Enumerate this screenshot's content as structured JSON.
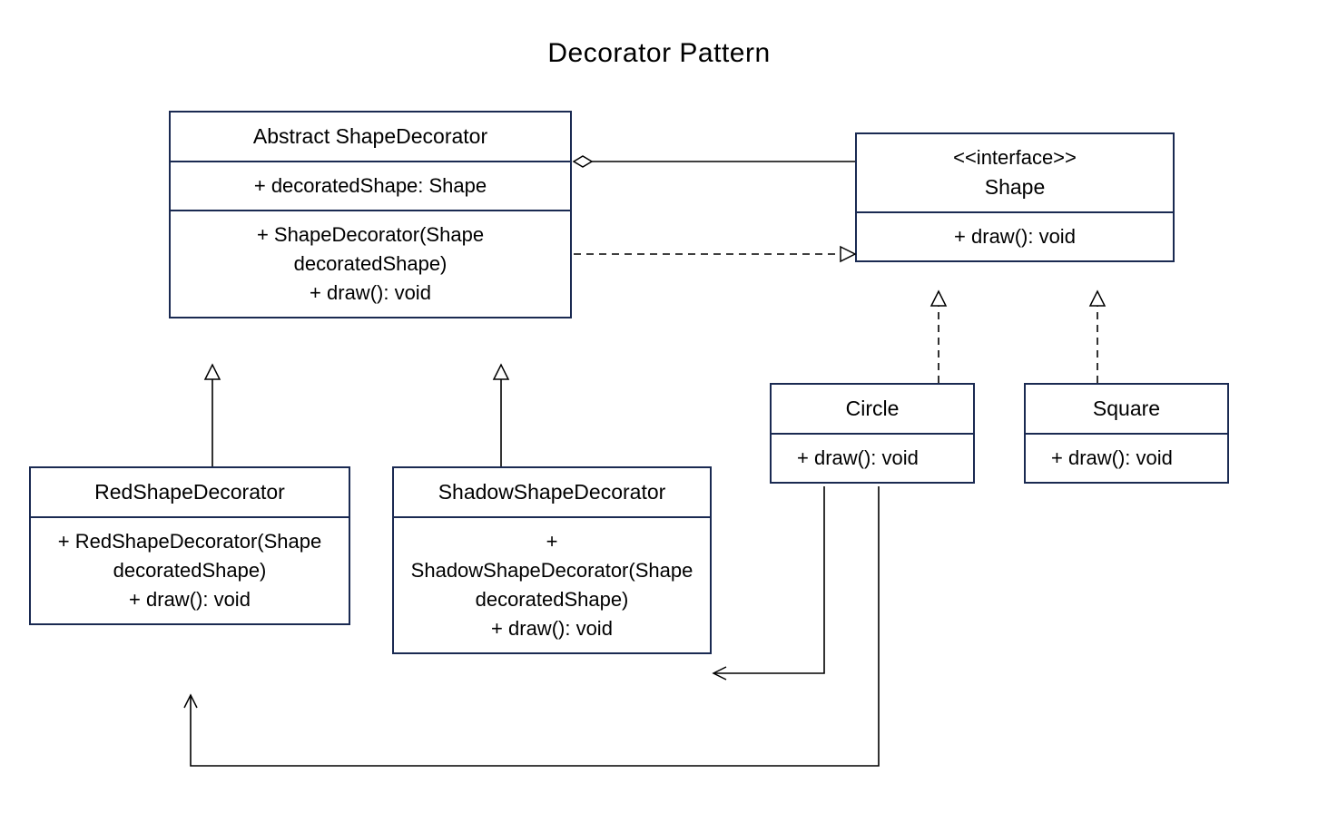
{
  "title": "Decorator Pattern",
  "classes": {
    "shapeDecorator": {
      "name": "Abstract ShapeDecorator",
      "attr1": "+  decoratedShape: Shape",
      "op1": "+  ShapeDecorator(Shape decoratedShape)",
      "op2": "+   draw(): void"
    },
    "shapeIface": {
      "stereo": "<<interface>>",
      "name": "Shape",
      "op1": "+   draw(): void"
    },
    "circle": {
      "name": "Circle",
      "op1": "+   draw(): void"
    },
    "square": {
      "name": "Square",
      "op1": "+   draw(): void"
    },
    "red": {
      "name": "RedShapeDecorator",
      "op1": "+ RedShapeDecorator(Shape decoratedShape)",
      "op2": "+   draw(): void"
    },
    "shadow": {
      "name": "ShadowShapeDecorator",
      "op1": "+ ShadowShapeDecorator(Shape decoratedShape)",
      "op2": "+   draw(): void"
    }
  },
  "relations": [
    {
      "type": "aggregation",
      "from": "shapeDecorator",
      "to": "shapeIface"
    },
    {
      "type": "realization-dashed",
      "from": "shapeDecorator",
      "to": "shapeIface"
    },
    {
      "type": "realization-dashed",
      "from": "circle",
      "to": "shapeIface"
    },
    {
      "type": "realization-dashed",
      "from": "square",
      "to": "shapeIface"
    },
    {
      "type": "generalization",
      "from": "red",
      "to": "shapeDecorator"
    },
    {
      "type": "generalization",
      "from": "shadow",
      "to": "shapeDecorator"
    },
    {
      "type": "association-arrow",
      "from": "circle",
      "to": "red"
    },
    {
      "type": "association-arrow",
      "from": "circle",
      "to": "shadow"
    }
  ]
}
